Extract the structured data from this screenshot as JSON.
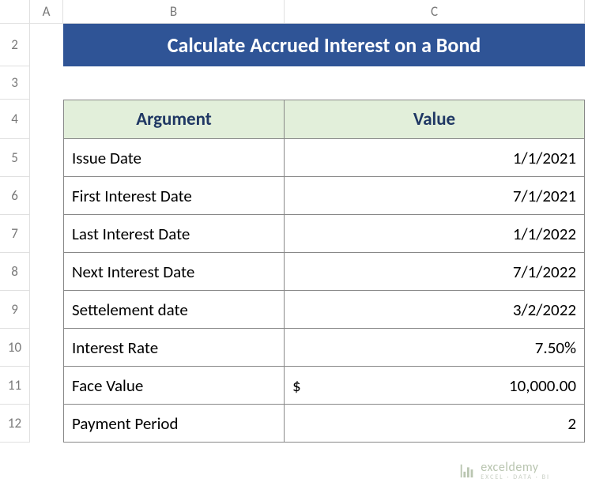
{
  "columns": [
    "A",
    "B",
    "C"
  ],
  "rows": [
    "2",
    "3",
    "4",
    "5",
    "6",
    "7",
    "8",
    "9",
    "10",
    "11",
    "12"
  ],
  "title": "Calculate Accrued Interest on a Bond",
  "table": {
    "headers": {
      "argument": "Argument",
      "value": "Value"
    },
    "rows": [
      {
        "label": "Issue Date",
        "value": "1/1/2021"
      },
      {
        "label": "First Interest Date",
        "value": "7/1/2021"
      },
      {
        "label": "Last Interest Date",
        "value": "1/1/2022"
      },
      {
        "label": "Next Interest Date",
        "value": "7/1/2022"
      },
      {
        "label": "Settelement date",
        "value": "3/2/2022"
      },
      {
        "label": "Interest Rate",
        "value": "7.50%"
      },
      {
        "label": "Face Value",
        "currency": "$",
        "value": "10,000.00"
      },
      {
        "label": "Payment Period",
        "value": "2"
      }
    ]
  },
  "watermark": {
    "brand": "exceldemy",
    "tag": "EXCEL · DATA · BI"
  },
  "chart_data": {
    "type": "table",
    "title": "Calculate Accrued Interest on a Bond",
    "columns": [
      "Argument",
      "Value"
    ],
    "rows": [
      [
        "Issue Date",
        "1/1/2021"
      ],
      [
        "First Interest Date",
        "7/1/2021"
      ],
      [
        "Last Interest Date",
        "1/1/2022"
      ],
      [
        "Next Interest Date",
        "7/1/2022"
      ],
      [
        "Settelement date",
        "3/2/2022"
      ],
      [
        "Interest Rate",
        "7.50%"
      ],
      [
        "Face Value",
        "$ 10,000.00"
      ],
      [
        "Payment Period",
        "2"
      ]
    ]
  }
}
